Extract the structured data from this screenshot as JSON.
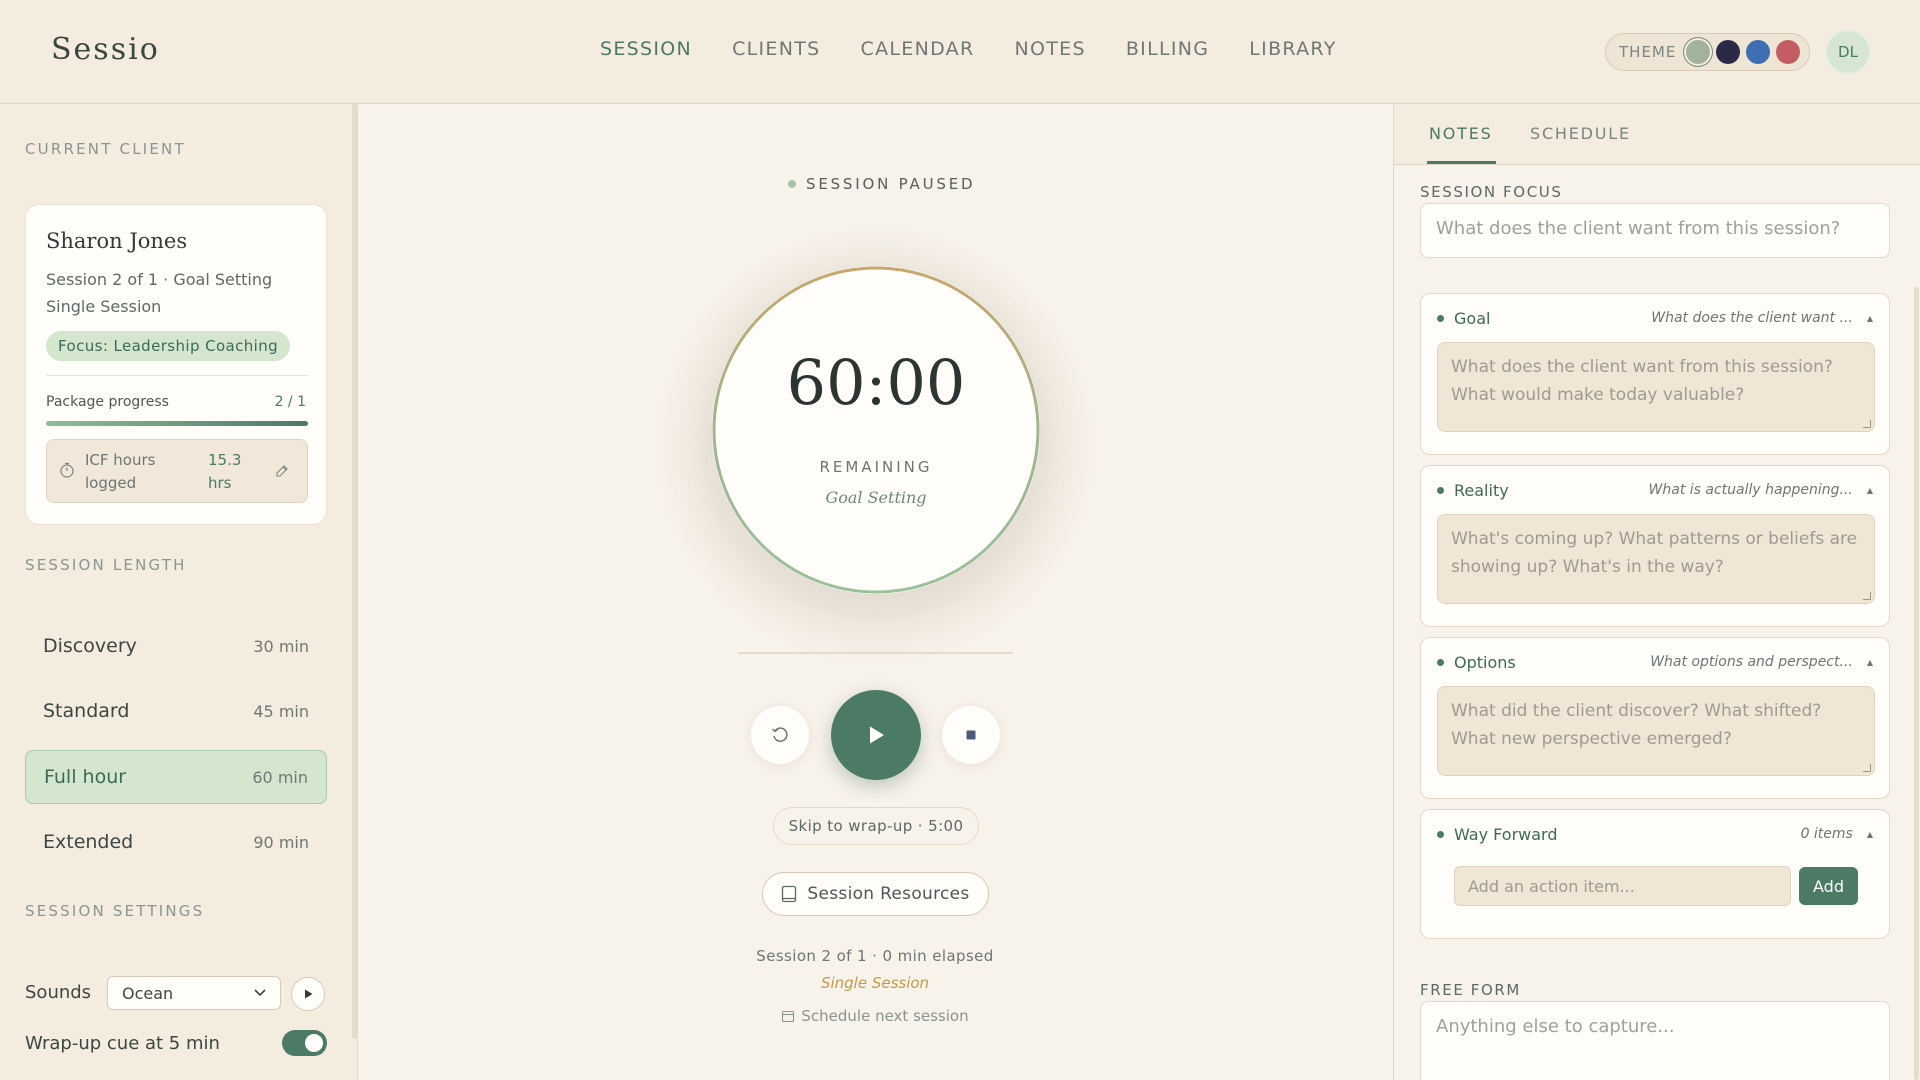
{
  "app": {
    "logo": "Sessio"
  },
  "nav": {
    "items": [
      "SESSION",
      "CLIENTS",
      "CALENDAR",
      "NOTES",
      "BILLING",
      "LIBRARY"
    ],
    "active": "SESSION"
  },
  "theme": {
    "label": "THEME",
    "swatches": [
      "#a3b29a",
      "#2a2a48",
      "#3f6fb3",
      "#c45c63"
    ],
    "selected": 0
  },
  "user": {
    "initials": "DL"
  },
  "left": {
    "current_client_title": "CURRENT CLIENT",
    "client": {
      "name": "Sharon Jones",
      "session_line": "Session 2 of 1 · Goal Setting",
      "type_line": "Single Session",
      "focus_tag": "Focus: Leadership Coaching",
      "package_label": "Package progress",
      "package_value": "2 / 1",
      "package_fraction": 1.0,
      "icf_label": "ICF hours logged",
      "icf_value": "15.3 hrs"
    },
    "session_length_title": "SESSION LENGTH",
    "lengths": [
      {
        "name": "Discovery",
        "minutes": "30 min"
      },
      {
        "name": "Standard",
        "minutes": "45 min"
      },
      {
        "name": "Full hour",
        "minutes": "60 min"
      },
      {
        "name": "Extended",
        "minutes": "90 min"
      }
    ],
    "active_length": 2,
    "settings_title": "SESSION SETTINGS",
    "sounds_label": "Sounds",
    "sound_value": "Ocean",
    "wrapup_label": "Wrap-up cue at 5 min",
    "wrapup_on": true
  },
  "center": {
    "status": "SESSION PAUSED",
    "time": "60:00",
    "remaining": "REMAINING",
    "session_name": "Goal Setting",
    "skip": "Skip to wrap-up · 5:00",
    "resources": "Session Resources",
    "info": "Session 2 of 1 · 0 min elapsed",
    "type": "Single Session",
    "schedule": "Schedule next session"
  },
  "right": {
    "tabs": [
      "NOTES",
      "SCHEDULE"
    ],
    "active_tab": "NOTES",
    "focus_label": "SESSION FOCUS",
    "focus_placeholder": "What does the client want from this session?",
    "grow": [
      {
        "title": "Goal",
        "hint": "What does the client want ...",
        "placeholder": "What does the client want from this session? What would make today valuable?"
      },
      {
        "title": "Reality",
        "hint": "What is actually happening...",
        "placeholder": "What's coming up? What patterns or beliefs are showing up? What's in the way?"
      },
      {
        "title": "Options",
        "hint": "What options and perspect...",
        "placeholder": "What did the client discover? What shifted? What new perspective emerged?"
      }
    ],
    "way_forward": {
      "title": "Way Forward",
      "count": "0 items",
      "placeholder": "Add an action item...",
      "add_label": "Add"
    },
    "free_form_label": "FREE FORM",
    "free_form_placeholder": "Anything else to capture..."
  }
}
